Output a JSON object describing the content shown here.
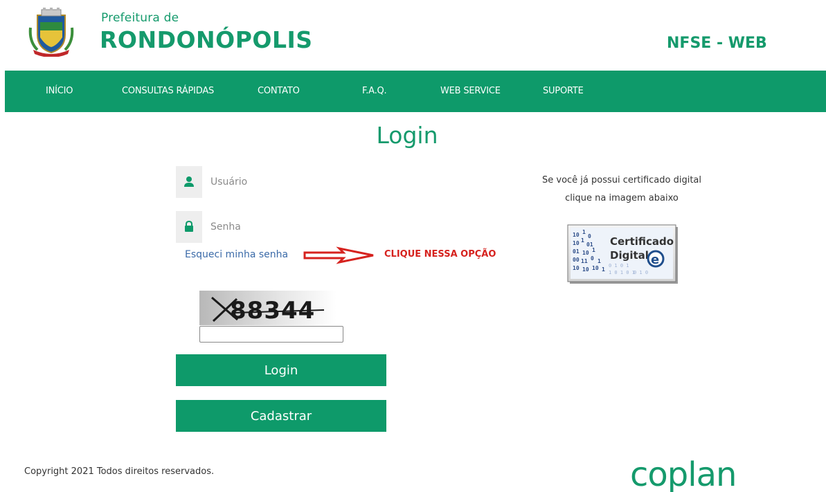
{
  "header": {
    "brand_sub": "Prefeitura de",
    "brand_main": "RONDONÓPOLIS",
    "system_name": "NFSE - WEB"
  },
  "nav": {
    "items": [
      "INÍCIO",
      "CONSULTAS RÁPIDAS",
      "CONTATO",
      "F.A.Q.",
      "WEB SERVICE",
      "SUPORTE"
    ]
  },
  "login": {
    "title": "Login",
    "user_placeholder": "Usuário",
    "pass_placeholder": "Senha",
    "forgot_label": "Esqueci minha senha",
    "hint_label": "CLIQUE NESSA OPÇÃO",
    "captcha_text": "88344",
    "login_button": "Login",
    "register_button": "Cadastrar"
  },
  "certificate": {
    "line1": "Se você já possui certificado digital",
    "line2": "clique na imagem abaixo",
    "img_word1": "Certificado",
    "img_word2": "Digital",
    "img_badge": "e"
  },
  "footer": {
    "copyright": "Copyright 2021 Todos direitos reservados.",
    "logo_text": "coplan"
  },
  "colors": {
    "brand_green": "#0e9a6a",
    "hint_red": "#d6221e",
    "link_blue": "#3a6aa8"
  }
}
